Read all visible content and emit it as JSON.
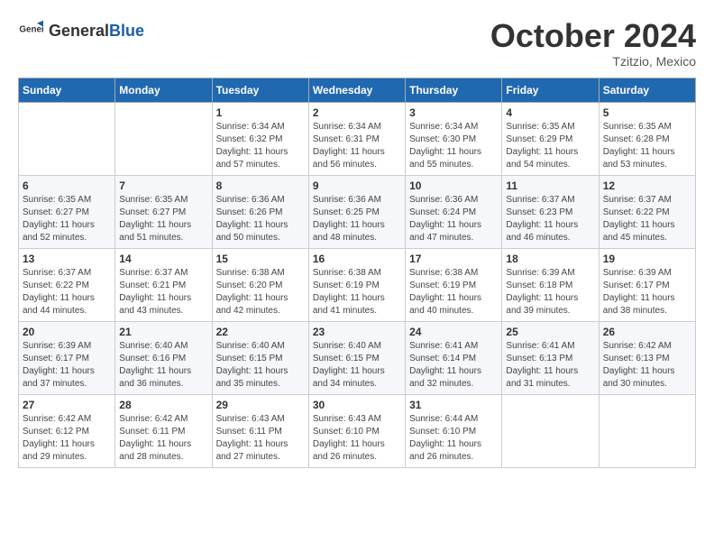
{
  "header": {
    "logo_general": "General",
    "logo_blue": "Blue",
    "month_title": "October 2024",
    "location": "Tzitzio, Mexico"
  },
  "days_of_week": [
    "Sunday",
    "Monday",
    "Tuesday",
    "Wednesday",
    "Thursday",
    "Friday",
    "Saturday"
  ],
  "weeks": [
    [
      {
        "day": "",
        "info": ""
      },
      {
        "day": "",
        "info": ""
      },
      {
        "day": "1",
        "info": "Sunrise: 6:34 AM\nSunset: 6:32 PM\nDaylight: 11 hours and 57 minutes."
      },
      {
        "day": "2",
        "info": "Sunrise: 6:34 AM\nSunset: 6:31 PM\nDaylight: 11 hours and 56 minutes."
      },
      {
        "day": "3",
        "info": "Sunrise: 6:34 AM\nSunset: 6:30 PM\nDaylight: 11 hours and 55 minutes."
      },
      {
        "day": "4",
        "info": "Sunrise: 6:35 AM\nSunset: 6:29 PM\nDaylight: 11 hours and 54 minutes."
      },
      {
        "day": "5",
        "info": "Sunrise: 6:35 AM\nSunset: 6:28 PM\nDaylight: 11 hours and 53 minutes."
      }
    ],
    [
      {
        "day": "6",
        "info": "Sunrise: 6:35 AM\nSunset: 6:27 PM\nDaylight: 11 hours and 52 minutes."
      },
      {
        "day": "7",
        "info": "Sunrise: 6:35 AM\nSunset: 6:27 PM\nDaylight: 11 hours and 51 minutes."
      },
      {
        "day": "8",
        "info": "Sunrise: 6:36 AM\nSunset: 6:26 PM\nDaylight: 11 hours and 50 minutes."
      },
      {
        "day": "9",
        "info": "Sunrise: 6:36 AM\nSunset: 6:25 PM\nDaylight: 11 hours and 48 minutes."
      },
      {
        "day": "10",
        "info": "Sunrise: 6:36 AM\nSunset: 6:24 PM\nDaylight: 11 hours and 47 minutes."
      },
      {
        "day": "11",
        "info": "Sunrise: 6:37 AM\nSunset: 6:23 PM\nDaylight: 11 hours and 46 minutes."
      },
      {
        "day": "12",
        "info": "Sunrise: 6:37 AM\nSunset: 6:22 PM\nDaylight: 11 hours and 45 minutes."
      }
    ],
    [
      {
        "day": "13",
        "info": "Sunrise: 6:37 AM\nSunset: 6:22 PM\nDaylight: 11 hours and 44 minutes."
      },
      {
        "day": "14",
        "info": "Sunrise: 6:37 AM\nSunset: 6:21 PM\nDaylight: 11 hours and 43 minutes."
      },
      {
        "day": "15",
        "info": "Sunrise: 6:38 AM\nSunset: 6:20 PM\nDaylight: 11 hours and 42 minutes."
      },
      {
        "day": "16",
        "info": "Sunrise: 6:38 AM\nSunset: 6:19 PM\nDaylight: 11 hours and 41 minutes."
      },
      {
        "day": "17",
        "info": "Sunrise: 6:38 AM\nSunset: 6:19 PM\nDaylight: 11 hours and 40 minutes."
      },
      {
        "day": "18",
        "info": "Sunrise: 6:39 AM\nSunset: 6:18 PM\nDaylight: 11 hours and 39 minutes."
      },
      {
        "day": "19",
        "info": "Sunrise: 6:39 AM\nSunset: 6:17 PM\nDaylight: 11 hours and 38 minutes."
      }
    ],
    [
      {
        "day": "20",
        "info": "Sunrise: 6:39 AM\nSunset: 6:17 PM\nDaylight: 11 hours and 37 minutes."
      },
      {
        "day": "21",
        "info": "Sunrise: 6:40 AM\nSunset: 6:16 PM\nDaylight: 11 hours and 36 minutes."
      },
      {
        "day": "22",
        "info": "Sunrise: 6:40 AM\nSunset: 6:15 PM\nDaylight: 11 hours and 35 minutes."
      },
      {
        "day": "23",
        "info": "Sunrise: 6:40 AM\nSunset: 6:15 PM\nDaylight: 11 hours and 34 minutes."
      },
      {
        "day": "24",
        "info": "Sunrise: 6:41 AM\nSunset: 6:14 PM\nDaylight: 11 hours and 32 minutes."
      },
      {
        "day": "25",
        "info": "Sunrise: 6:41 AM\nSunset: 6:13 PM\nDaylight: 11 hours and 31 minutes."
      },
      {
        "day": "26",
        "info": "Sunrise: 6:42 AM\nSunset: 6:13 PM\nDaylight: 11 hours and 30 minutes."
      }
    ],
    [
      {
        "day": "27",
        "info": "Sunrise: 6:42 AM\nSunset: 6:12 PM\nDaylight: 11 hours and 29 minutes."
      },
      {
        "day": "28",
        "info": "Sunrise: 6:42 AM\nSunset: 6:11 PM\nDaylight: 11 hours and 28 minutes."
      },
      {
        "day": "29",
        "info": "Sunrise: 6:43 AM\nSunset: 6:11 PM\nDaylight: 11 hours and 27 minutes."
      },
      {
        "day": "30",
        "info": "Sunrise: 6:43 AM\nSunset: 6:10 PM\nDaylight: 11 hours and 26 minutes."
      },
      {
        "day": "31",
        "info": "Sunrise: 6:44 AM\nSunset: 6:10 PM\nDaylight: 11 hours and 26 minutes."
      },
      {
        "day": "",
        "info": ""
      },
      {
        "day": "",
        "info": ""
      }
    ]
  ]
}
